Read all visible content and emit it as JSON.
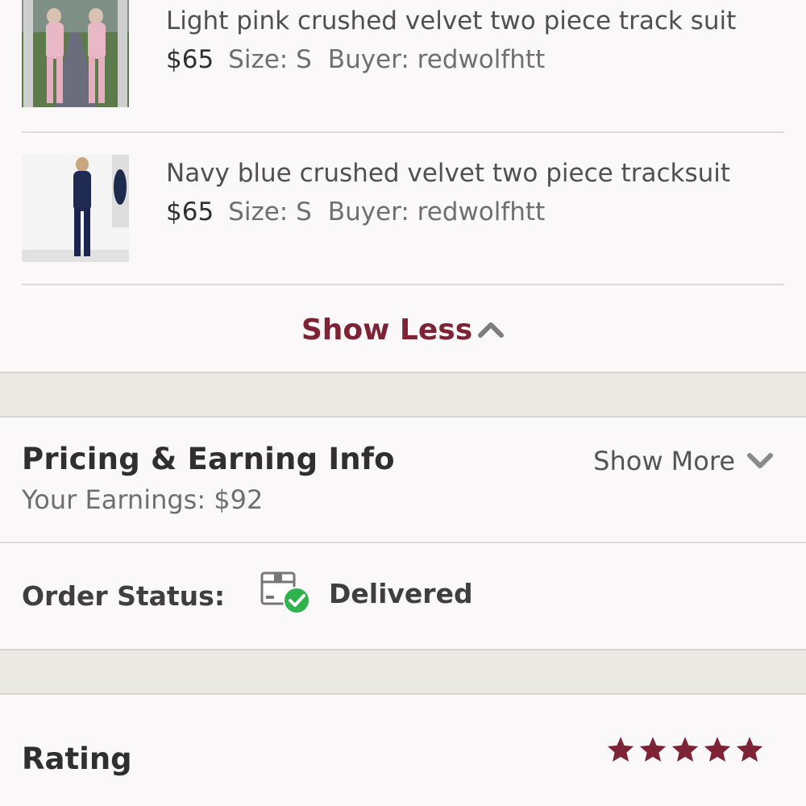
{
  "items": [
    {
      "title": "Light pink crushed velvet two piece track suit",
      "price": "$65",
      "size": "Size: S",
      "buyer": "Buyer: redwolfhtt"
    },
    {
      "title": "Navy blue crushed velvet two piece tracksuit",
      "price": "$65",
      "size": "Size: S",
      "buyer": "Buyer: redwolfhtt"
    }
  ],
  "toggle": {
    "show_less": "Show Less",
    "show_more": "Show More"
  },
  "pricing": {
    "title": "Pricing & Earning Info",
    "earnings": "Your Earnings: $92"
  },
  "order": {
    "label": "Order Status:",
    "status": "Delivered",
    "status_color": "#2fb24c"
  },
  "rating": {
    "label": "Rating",
    "stars": 5,
    "max_stars": 5,
    "star_color": "#7d2335"
  },
  "colors": {
    "accent": "#7d2335",
    "band": "#ebe9e4",
    "background": "#faf8f9"
  }
}
